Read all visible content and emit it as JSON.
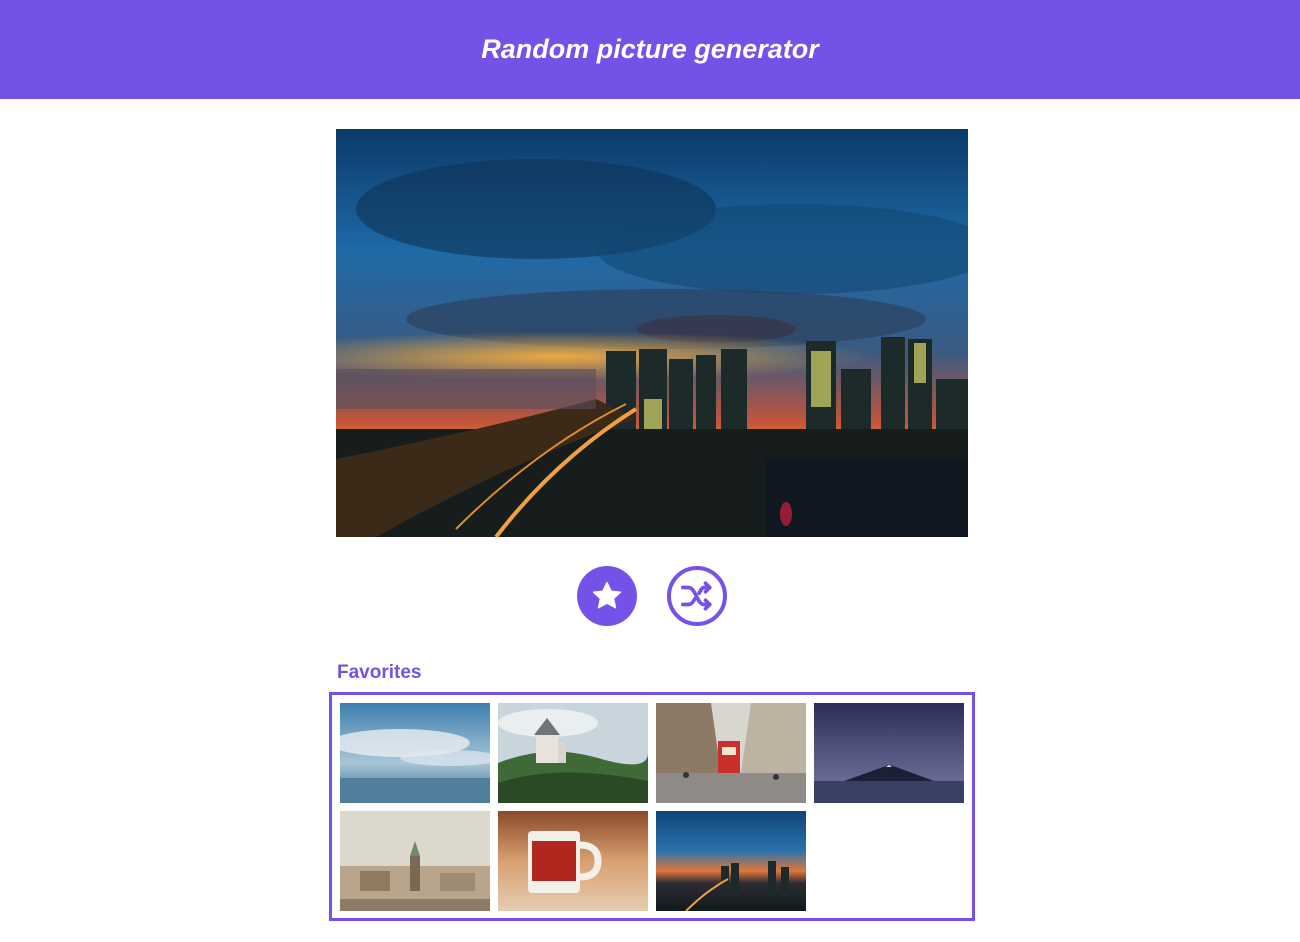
{
  "header": {
    "title": "Random picture generator"
  },
  "colors": {
    "accent": "#7452e8",
    "background": "#ffffff"
  },
  "main_picture": {
    "subject": "city-skyline-sunset"
  },
  "actions": {
    "favorite_icon": "star-icon",
    "shuffle_icon": "shuffle-icon"
  },
  "favorites": {
    "label": "Favorites",
    "items": [
      {
        "subject": "sea-clouds"
      },
      {
        "subject": "castle-forest"
      },
      {
        "subject": "tram-street"
      },
      {
        "subject": "night-mountain-lake"
      },
      {
        "subject": "old-town-rooftops"
      },
      {
        "subject": "red-mug"
      },
      {
        "subject": "city-skyline-sunset"
      }
    ]
  }
}
